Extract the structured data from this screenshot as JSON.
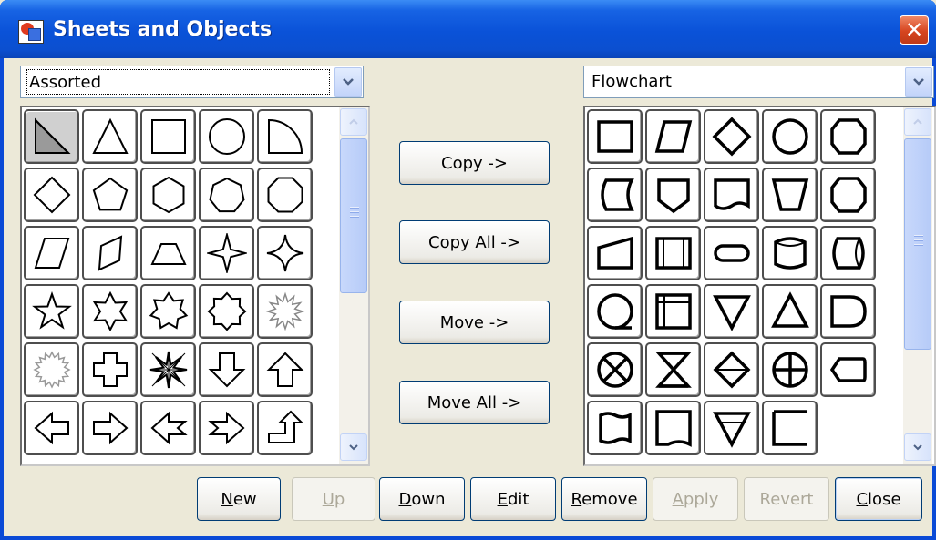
{
  "window": {
    "title": "Sheets and Objects",
    "close_glyph": "✕"
  },
  "left_combo": {
    "value": "Assorted"
  },
  "right_combo": {
    "value": "Flowchart"
  },
  "middle_buttons": [
    {
      "label": "Copy ->"
    },
    {
      "label": "Copy All ->"
    },
    {
      "label": "Move ->"
    },
    {
      "label": "Move All ->"
    }
  ],
  "bottom_buttons": [
    {
      "label": "New",
      "mnemonic": "N",
      "enabled": true
    },
    {
      "label": "Up",
      "mnemonic": "U",
      "enabled": false
    },
    {
      "label": "Down",
      "mnemonic": "D",
      "enabled": true
    },
    {
      "label": "Edit",
      "mnemonic": "E",
      "enabled": true
    },
    {
      "label": "Remove",
      "mnemonic": "R",
      "enabled": true
    },
    {
      "label": "Apply",
      "mnemonic": "A",
      "enabled": false
    },
    {
      "label": "Revert",
      "mnemonic": "",
      "enabled": false
    },
    {
      "label": "Close",
      "mnemonic": "C",
      "enabled": true
    }
  ],
  "left_shapes": [
    "right-triangle",
    "triangle",
    "square",
    "circle",
    "quarter-circle",
    "diamond",
    "pentagon",
    "hexagon",
    "heptagon",
    "octagon",
    "parallelogram",
    "skewed-quad",
    "trapezoid",
    "star-4",
    "star-4-concave",
    "star-5",
    "star-6",
    "star-7",
    "star-8",
    "star-burst",
    "star-16",
    "cross",
    "star-burst-2",
    "arrow-down",
    "arrow-up",
    "arrow-left",
    "arrow-right",
    "arrow-left-notched",
    "arrow-right-notched",
    "arrow-up-left-turn"
  ],
  "right_shapes": [
    "process",
    "data",
    "decision",
    "connector",
    "preparation",
    "stored-data",
    "off-page",
    "document",
    "manual-operation",
    "terminator-octagon",
    "manual-input",
    "predefined-process",
    "terminator",
    "magnetic-disk",
    "direct-access",
    "sequential-access",
    "internal-storage",
    "merge",
    "extract",
    "delay",
    "summing-junction",
    "collate",
    "sort",
    "or",
    "display",
    "punched-tape",
    "card",
    "merge-2",
    "display-2"
  ],
  "colors": {
    "titlebar": "#0a52d8",
    "face": "#ece9d8",
    "close": "#d6451f"
  }
}
